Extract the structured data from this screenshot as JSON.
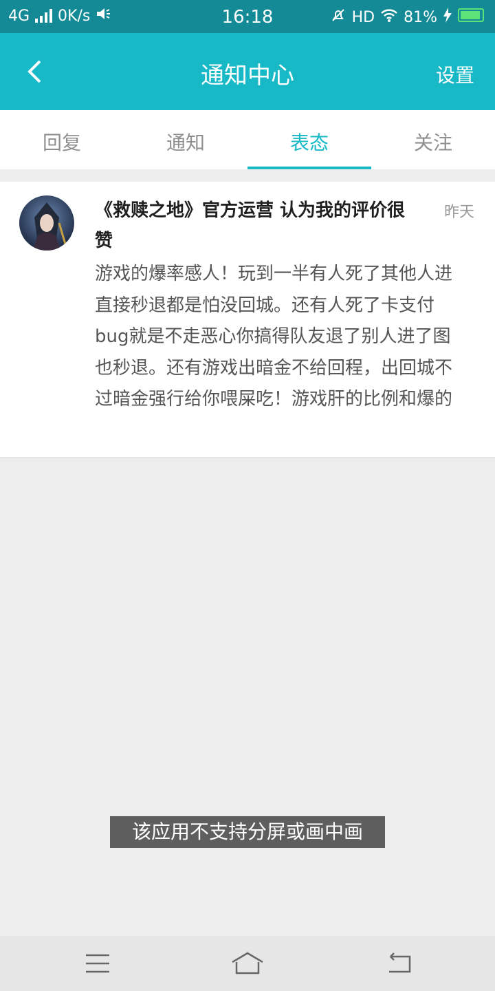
{
  "status_bar": {
    "network": "4G",
    "speed": "0K/s",
    "time": "16:18",
    "hd": "HD",
    "battery": "81%"
  },
  "app_bar": {
    "title": "通知中心",
    "settings_label": "设置"
  },
  "tabs": [
    {
      "label": "回复",
      "active": false
    },
    {
      "label": "通知",
      "active": false
    },
    {
      "label": "表态",
      "active": true
    },
    {
      "label": "关注",
      "active": false
    }
  ],
  "notifications": [
    {
      "title": "《救赎之地》官方运营 认为我的评价很赞",
      "time": "昨天",
      "body": "游戏的爆率感人！玩到一半有人死了其他人进直接秒退都是怕没回城。还有人死了卡支付bug就是不走恶心你搞得队友退了别人进了图也秒退。还有游戏出暗金不给回程，出回城不过暗金强行给你喂屎吃！游戏肝的比例和爆的"
    }
  ],
  "toast": "该应用不支持分屏或画中画",
  "colors": {
    "status_bar": "#138a95",
    "accent": "#17b9c7",
    "background": "#ededed"
  }
}
